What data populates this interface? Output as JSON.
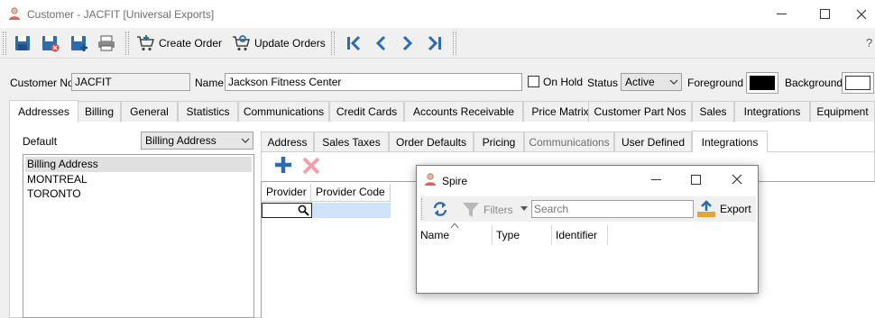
{
  "window": {
    "title": "Customer - JACFIT [Universal Exports]",
    "controls": [
      "minimize",
      "maximize",
      "close"
    ]
  },
  "toolbar": {
    "create_order": "Create Order",
    "update_orders": "Update Orders",
    "help": "?"
  },
  "header": {
    "customer_no_label": "Customer No",
    "customer_no_value": "JACFIT",
    "name_label": "Name",
    "name_value": "Jackson Fitness Center",
    "on_hold_label": "On Hold",
    "status_label": "Status",
    "status_value": "Active",
    "foreground_label": "Foreground",
    "background_label": "Background",
    "foreground_color": "#000000",
    "background_color": "#ffffff"
  },
  "main_tabs": [
    {
      "label": "Addresses",
      "active": true
    },
    {
      "label": "Billing"
    },
    {
      "label": "General"
    },
    {
      "label": "Statistics"
    },
    {
      "label": "Communications"
    },
    {
      "label": "Credit Cards"
    },
    {
      "label": "Accounts Receivable"
    },
    {
      "label": "Price Matrix"
    },
    {
      "label": "Customer Part Nos"
    },
    {
      "label": "Sales"
    },
    {
      "label": "Integrations"
    },
    {
      "label": "Equipment"
    }
  ],
  "addresses": {
    "default_label": "Default",
    "default_value": "Billing Address",
    "items": [
      {
        "label": "Billing Address",
        "selected": true
      },
      {
        "label": "MONTREAL"
      },
      {
        "label": "TORONTO"
      }
    ]
  },
  "sub_tabs": [
    {
      "label": "Address"
    },
    {
      "label": "Sales Taxes"
    },
    {
      "label": "Order Defaults"
    },
    {
      "label": "Pricing"
    },
    {
      "label": "Communications",
      "disabled": true
    },
    {
      "label": "User Defined"
    },
    {
      "label": "Integrations",
      "active": true
    }
  ],
  "integrations_grid": {
    "columns": [
      "Provider",
      "Provider Code"
    ]
  },
  "dialog": {
    "title": "Spire",
    "filters_label": "Filters",
    "search_placeholder": "Search",
    "export_label": "Export",
    "columns": [
      "Name",
      "Type",
      "Identifier"
    ]
  },
  "colors": {
    "accent_blue": "#2b6cb0",
    "delete_pink": "#f4a0a8",
    "selection": "#cfe3fb"
  }
}
